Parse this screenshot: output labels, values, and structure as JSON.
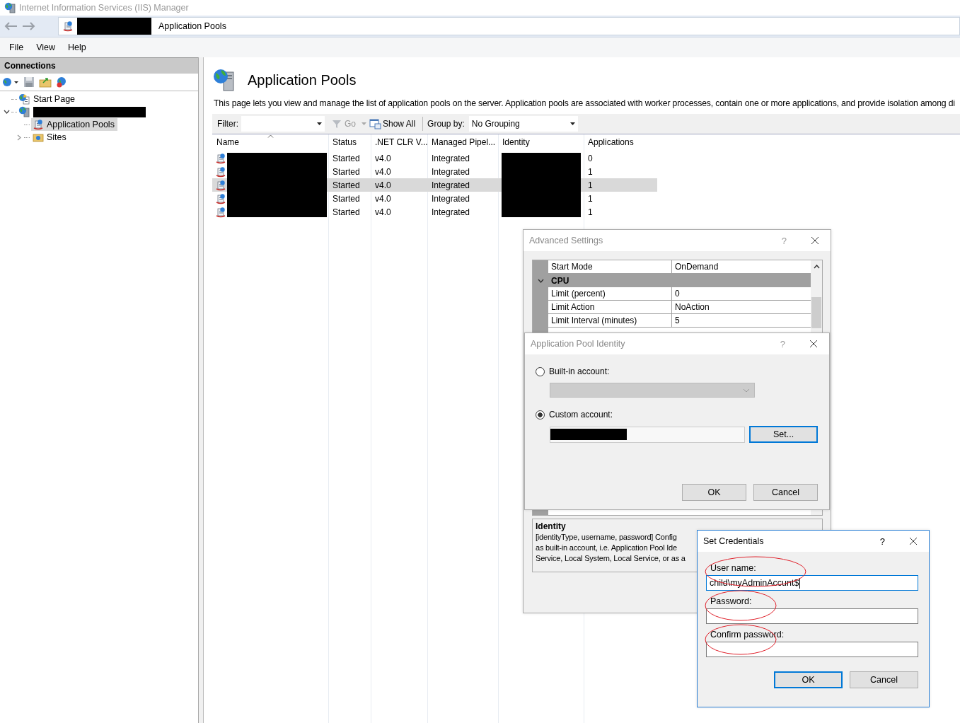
{
  "window": {
    "title": "Internet Information Services (IIS) Manager"
  },
  "address_bar": {
    "path": "Application Pools"
  },
  "menu": [
    "File",
    "View",
    "Help"
  ],
  "connections": {
    "title": "Connections",
    "tree": [
      {
        "kind": "start",
        "label": "Start Page"
      },
      {
        "kind": "server",
        "redacted": true,
        "expanded": true,
        "children": [
          {
            "kind": "pools",
            "label": "Application Pools",
            "selected": true
          },
          {
            "kind": "sites",
            "label": "Sites",
            "selected": false,
            "expanded": false
          }
        ]
      }
    ]
  },
  "content": {
    "title": "Application Pools",
    "description": "This page lets you view and manage the list of application pools on the server. Application pools are associated with worker processes, contain one or more applications, and provide isolation among di",
    "filter": {
      "label": "Filter:",
      "go": "Go",
      "show_all": "Show All",
      "group_by_label": "Group by:",
      "group_by_value": "No Grouping"
    },
    "table": {
      "columns": [
        "Name",
        "Status",
        ".NET CLR V...",
        "Managed Pipel...",
        "Identity",
        "Applications"
      ],
      "rows": [
        {
          "status": "Started",
          "clr": "v4.0",
          "pipeline": "Integrated",
          "applications": "0",
          "selected": false
        },
        {
          "status": "Started",
          "clr": "v4.0",
          "pipeline": "Integrated",
          "applications": "1",
          "selected": false
        },
        {
          "status": "Started",
          "clr": "v4.0",
          "pipeline": "Integrated",
          "applications": "1",
          "selected": true
        },
        {
          "status": "Started",
          "clr": "v4.0",
          "pipeline": "Integrated",
          "applications": "1",
          "selected": false
        },
        {
          "status": "Started",
          "clr": "v4.0",
          "pipeline": "Integrated",
          "applications": "1",
          "selected": false
        }
      ]
    }
  },
  "advanced_settings": {
    "title": "Advanced Settings",
    "help": "?",
    "rows": [
      {
        "kind": "property",
        "name": "Start Mode",
        "value": "OnDemand"
      },
      {
        "kind": "category",
        "name": "CPU",
        "expanded": true
      },
      {
        "kind": "property",
        "name": "Limit (percent)",
        "value": "0"
      },
      {
        "kind": "property",
        "name": "Limit Action",
        "value": "NoAction"
      },
      {
        "kind": "property",
        "name": "Limit Interval (minutes)",
        "value": "5"
      }
    ],
    "description": {
      "title": "Identity",
      "lines": [
        "[identityType, username, password] Config",
        "as built-in account, i.e. Application Pool Ide",
        "Service, Local System, Local Service, or as a"
      ]
    }
  },
  "identity_dialog": {
    "title": "Application Pool Identity",
    "help": "?",
    "options": [
      {
        "label": "Built-in account:",
        "selected": false
      },
      {
        "label": "Custom account:",
        "selected": true
      }
    ],
    "set_button": "Set...",
    "buttons": [
      "OK",
      "Cancel"
    ]
  },
  "credentials_dialog": {
    "title": "Set Credentials",
    "help": "?",
    "fields": [
      {
        "label": "User name:",
        "value": "child\\myAdminAccunt$",
        "focused": true,
        "circled": true
      },
      {
        "label": "Password:",
        "focused": false,
        "circled": true
      },
      {
        "label": "Confirm password:",
        "focused": false,
        "circled": true
      }
    ],
    "buttons": [
      {
        "label": "OK",
        "default": true
      },
      {
        "label": "Cancel",
        "default": false
      }
    ]
  }
}
